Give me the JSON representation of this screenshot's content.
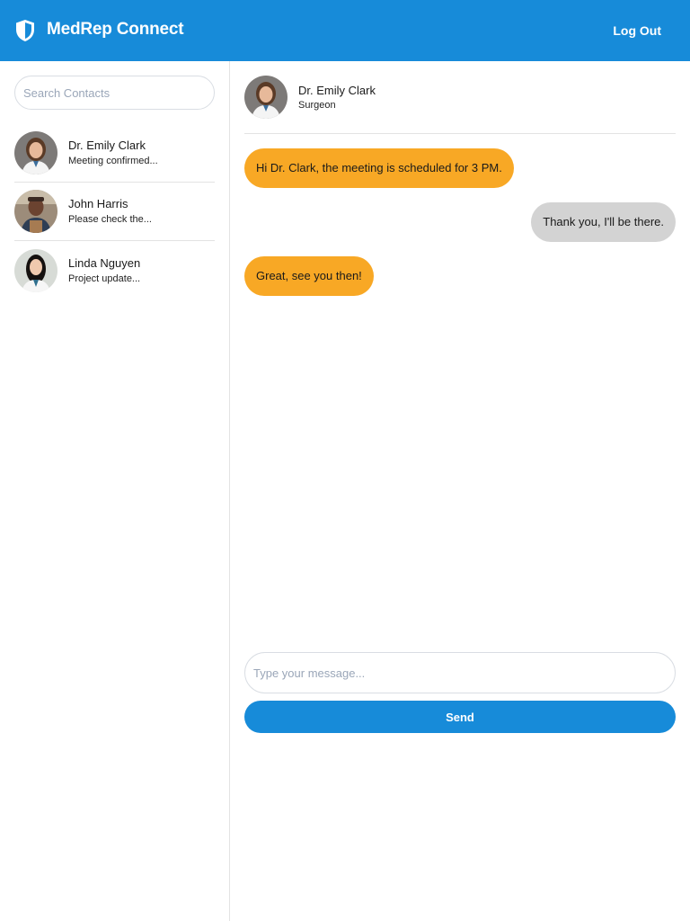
{
  "header": {
    "app_title": "MedRep Connect",
    "logout_label": "Log Out",
    "logo_icon": "shield-icon",
    "background_color": "#178bd9"
  },
  "sidebar": {
    "search_placeholder": "Search Contacts",
    "search_value": "",
    "contacts": [
      {
        "name": "Dr. Emily Clark",
        "preview": "Meeting confirmed...",
        "avatar": "avatar-photo"
      },
      {
        "name": "John Harris",
        "preview": "Please check the...",
        "avatar": "avatar-photo"
      },
      {
        "name": "Linda Nguyen",
        "preview": "Project update...",
        "avatar": "avatar-photo"
      }
    ]
  },
  "chat": {
    "contact_name": "Dr. Emily Clark",
    "contact_role": "Surgeon",
    "messages": [
      {
        "direction": "incoming",
        "text": "Hi Dr. Clark, the meeting is scheduled for 3 PM."
      },
      {
        "direction": "outgoing",
        "text": "Thank you, I'll be there."
      },
      {
        "direction": "incoming",
        "text": "Great, see you then!"
      }
    ],
    "incoming_color": "#f8a825",
    "outgoing_color": "#d3d3d3",
    "composer_placeholder": "Type your message...",
    "composer_value": "",
    "send_label": "Send"
  }
}
